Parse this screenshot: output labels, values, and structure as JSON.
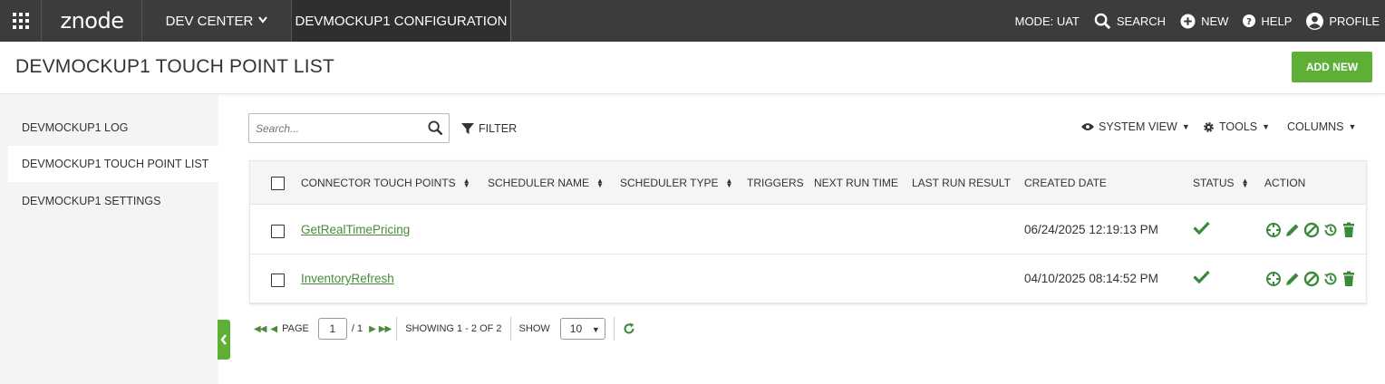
{
  "topbar": {
    "logo": "znode",
    "dev_center": "DEV CENTER",
    "config_tab": "DEVMOCKUP1 CONFIGURATION",
    "mode": "MODE: UAT",
    "search": "SEARCH",
    "new": "NEW",
    "help": "HELP",
    "profile": "PROFILE"
  },
  "header": {
    "title": "DEVMOCKUP1 TOUCH POINT LIST",
    "add_new": "ADD NEW"
  },
  "sidebar": {
    "items": [
      {
        "label": "DEVMOCKUP1 LOG",
        "active": false
      },
      {
        "label": "DEVMOCKUP1 TOUCH POINT LIST",
        "active": true
      },
      {
        "label": "DEVMOCKUP1 SETTINGS",
        "active": false
      }
    ]
  },
  "toolbar": {
    "search_placeholder": "Search...",
    "filter": "FILTER",
    "system_view": "SYSTEM VIEW",
    "tools": "TOOLS",
    "columns": "COLUMNS"
  },
  "table": {
    "columns": [
      "CONNECTOR TOUCH POINTS",
      "SCHEDULER NAME",
      "SCHEDULER TYPE",
      "TRIGGERS",
      "NEXT RUN TIME",
      "LAST RUN RESULT",
      "CREATED DATE",
      "STATUS",
      "ACTION"
    ],
    "rows": [
      {
        "name": "GetRealTimePricing",
        "created": "06/24/2025 12:19:13 PM",
        "status": "active"
      },
      {
        "name": "InventoryRefresh",
        "created": "04/10/2025 08:14:52 PM",
        "status": "active"
      }
    ]
  },
  "pager": {
    "page_label": "PAGE",
    "page": "1",
    "of": "/ 1",
    "showing": "SHOWING 1 - 2 OF 2",
    "show_label": "SHOW",
    "page_size": "10"
  },
  "colors": {
    "accent": "#5db035",
    "link": "#4a8a3a",
    "topbar": "#3c3c3c",
    "icon_green": "#3a8a3a"
  }
}
